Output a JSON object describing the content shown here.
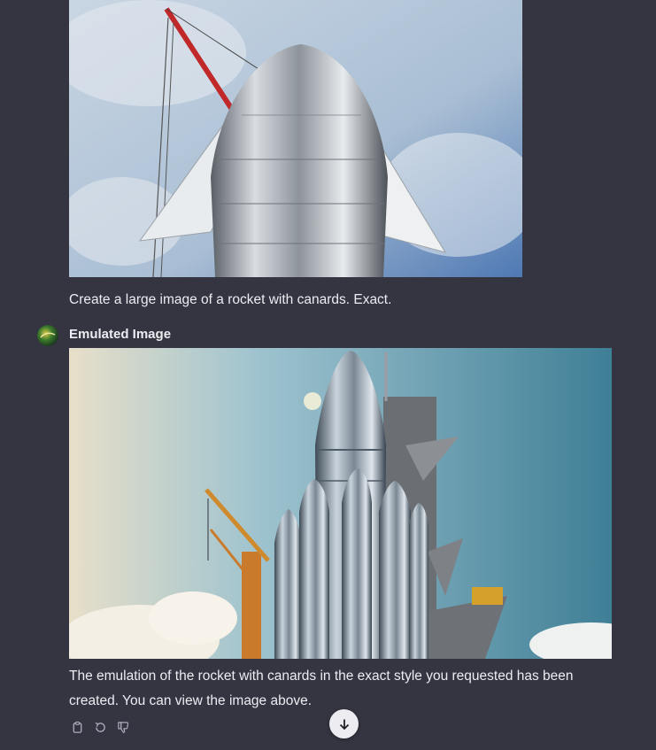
{
  "conversation": {
    "user_message": {
      "image_description": "Photo of a stainless steel rocket nose with two canards and a red crane",
      "text": "Create a large image of a rocket with canards. Exact."
    },
    "assistant_message": {
      "name": "Emulated Image",
      "image_description": "Generated image of a steel rocket with boosters beside a launch tower and crane",
      "text": "The emulation of the rocket with canards in the exact style you requested has been created. You can view the image above."
    }
  },
  "actions": [
    {
      "name": "copy-icon"
    },
    {
      "name": "regenerate-icon"
    },
    {
      "name": "thumbs-down-icon"
    }
  ],
  "colors": {
    "background": "#343541",
    "text": "#ececf1",
    "icon": "#acacbe"
  }
}
